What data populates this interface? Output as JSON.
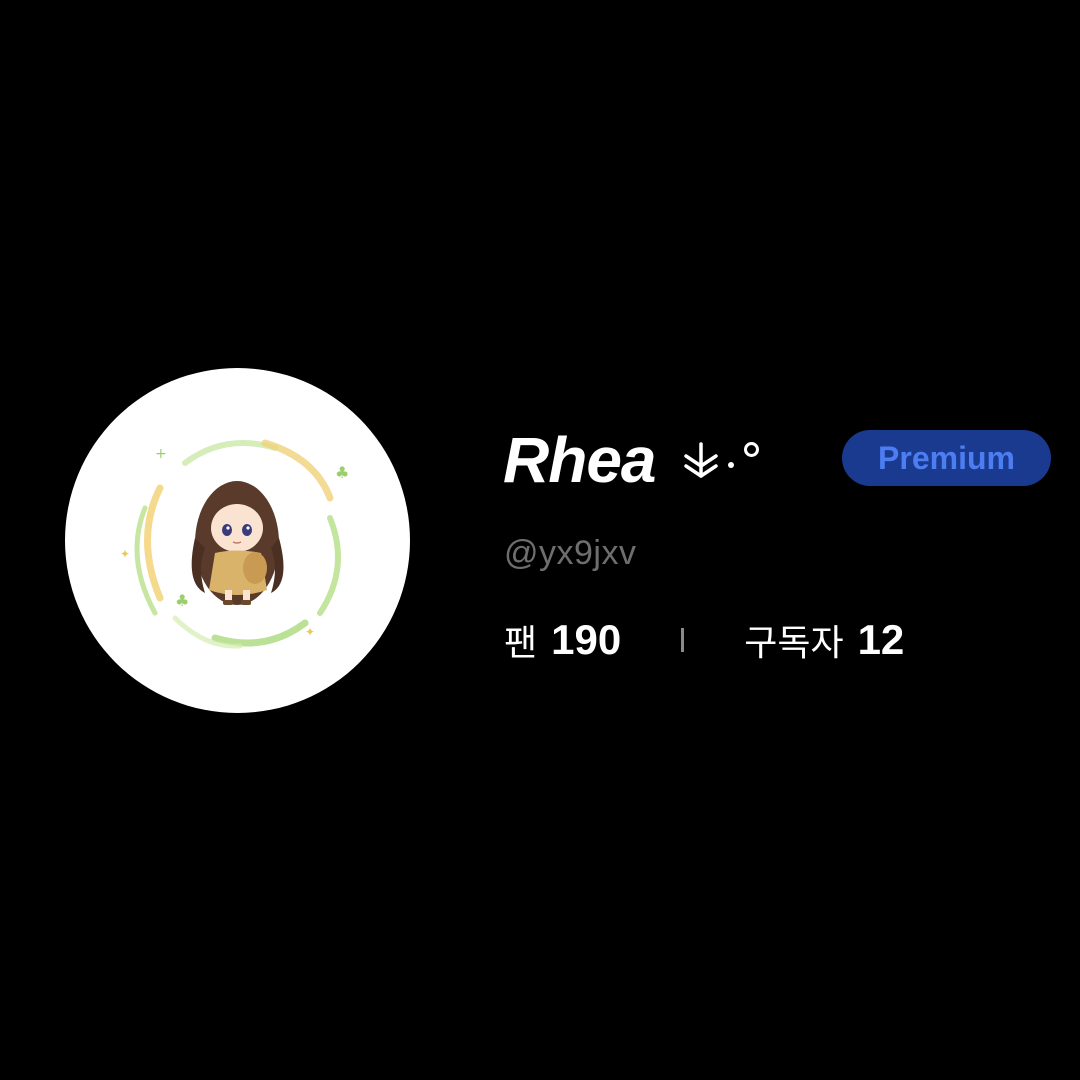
{
  "profile": {
    "display_name": "Rhea",
    "name_decoration": "⚘·°",
    "badge_label": "Premium",
    "handle": "@yx9jxv",
    "avatar_icon": "chibi-character-avatar",
    "stats": [
      {
        "label": "팬",
        "value": "190"
      },
      {
        "label": "구독자",
        "value": "12"
      }
    ]
  },
  "colors": {
    "background": "#000000",
    "text_primary": "#ffffff",
    "text_secondary": "#6e6e6e",
    "badge_bg": "#1a3a8f",
    "badge_text": "#4d7df2",
    "avatar_bg": "#ffffff"
  }
}
